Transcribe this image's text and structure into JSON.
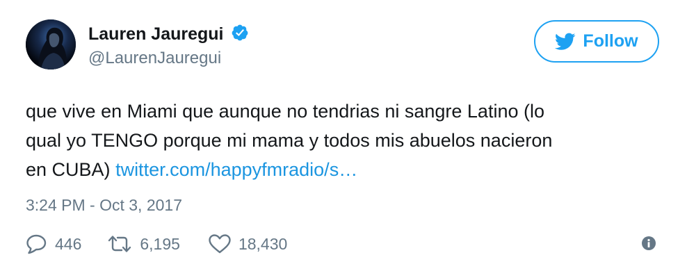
{
  "user": {
    "display_name": "Lauren Jauregui",
    "handle": "@LaurenJauregui",
    "verified": true
  },
  "follow_button": {
    "label": "Follow"
  },
  "tweet": {
    "text_lines": [
      "que vive en Miami que aunque no tendrias ni sangre Latino (lo",
      "qual yo TENGO porque mi mama y todos mis abuelos nacieron",
      "en CUBA)"
    ],
    "link_text": "twitter.com/happyfmradio/s…",
    "timestamp": "3:24 PM - Oct 3, 2017"
  },
  "actions": {
    "replies": "446",
    "retweets": "6,195",
    "likes": "18,430"
  },
  "icons": {
    "reply": "speech-bubble-icon",
    "retweet": "retweet-arrows-icon",
    "like": "heart-icon",
    "info": "info-circle-icon",
    "verified": "verified-badge-icon",
    "follow": "twitter-bird-icon"
  },
  "colors": {
    "accent": "#1da1f2",
    "link": "#1b95e0",
    "text": "#14171a",
    "secondary": "#657786"
  }
}
